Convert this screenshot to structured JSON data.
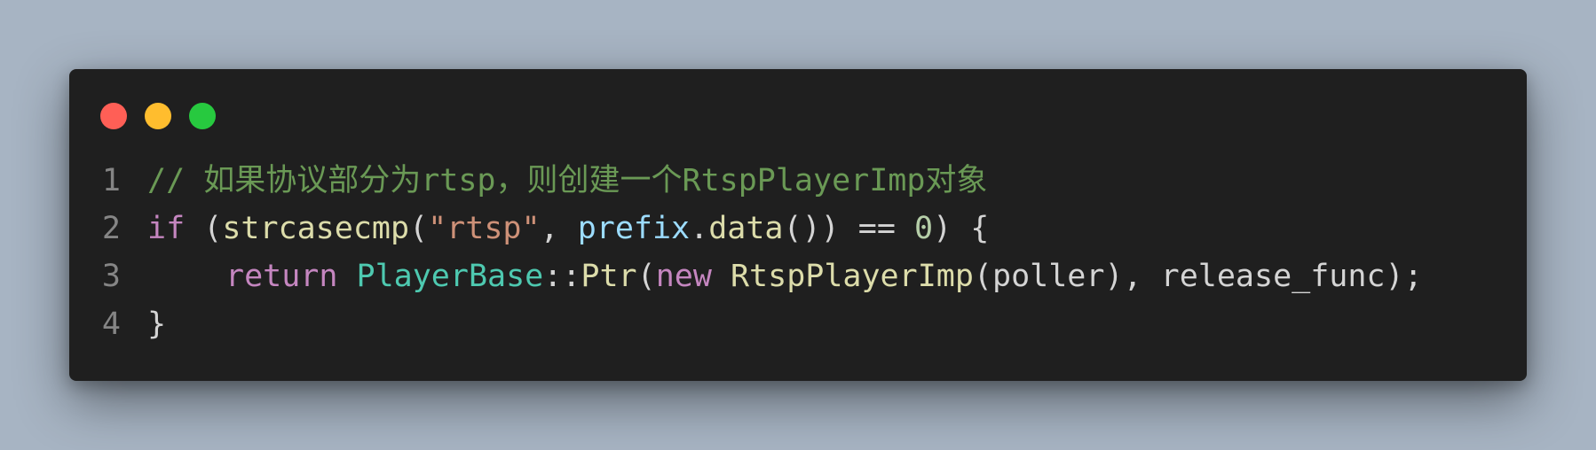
{
  "window": {
    "controls": [
      "close",
      "minimize",
      "maximize"
    ],
    "colors": {
      "background": "#1f1f1f",
      "close": "#ff5f56",
      "minimize": "#ffbd2e",
      "maximize": "#27c93f"
    }
  },
  "code": {
    "line_numbers": [
      "1",
      "2",
      "3",
      "4"
    ],
    "line1": {
      "comment": "// 如果协议部分为rtsp，则创建一个RtspPlayerImp对象"
    },
    "line2": {
      "kw_if": "if",
      "sp1": " ",
      "paren_open": "(",
      "fn_strcasecmp": "strcasecmp",
      "paren_open2": "(",
      "str_rtsp": "\"rtsp\"",
      "comma": ", ",
      "var_prefix": "prefix",
      "dot": ".",
      "fn_data": "data",
      "paren_close": "())",
      "op_eq": " == ",
      "num_zero": "0",
      "close_brace_open": ") {"
    },
    "line3": {
      "kw_return": "return",
      "sp": " ",
      "type_playerbase": "PlayerBase",
      "scope": "::",
      "fn_ptr": "Ptr",
      "paren_open": "(",
      "kw_new": "new",
      "sp2": " ",
      "fn_rtspplayerimp": "RtspPlayerImp",
      "args": "(poller), release_func);"
    },
    "line4": {
      "brace": "}"
    }
  }
}
